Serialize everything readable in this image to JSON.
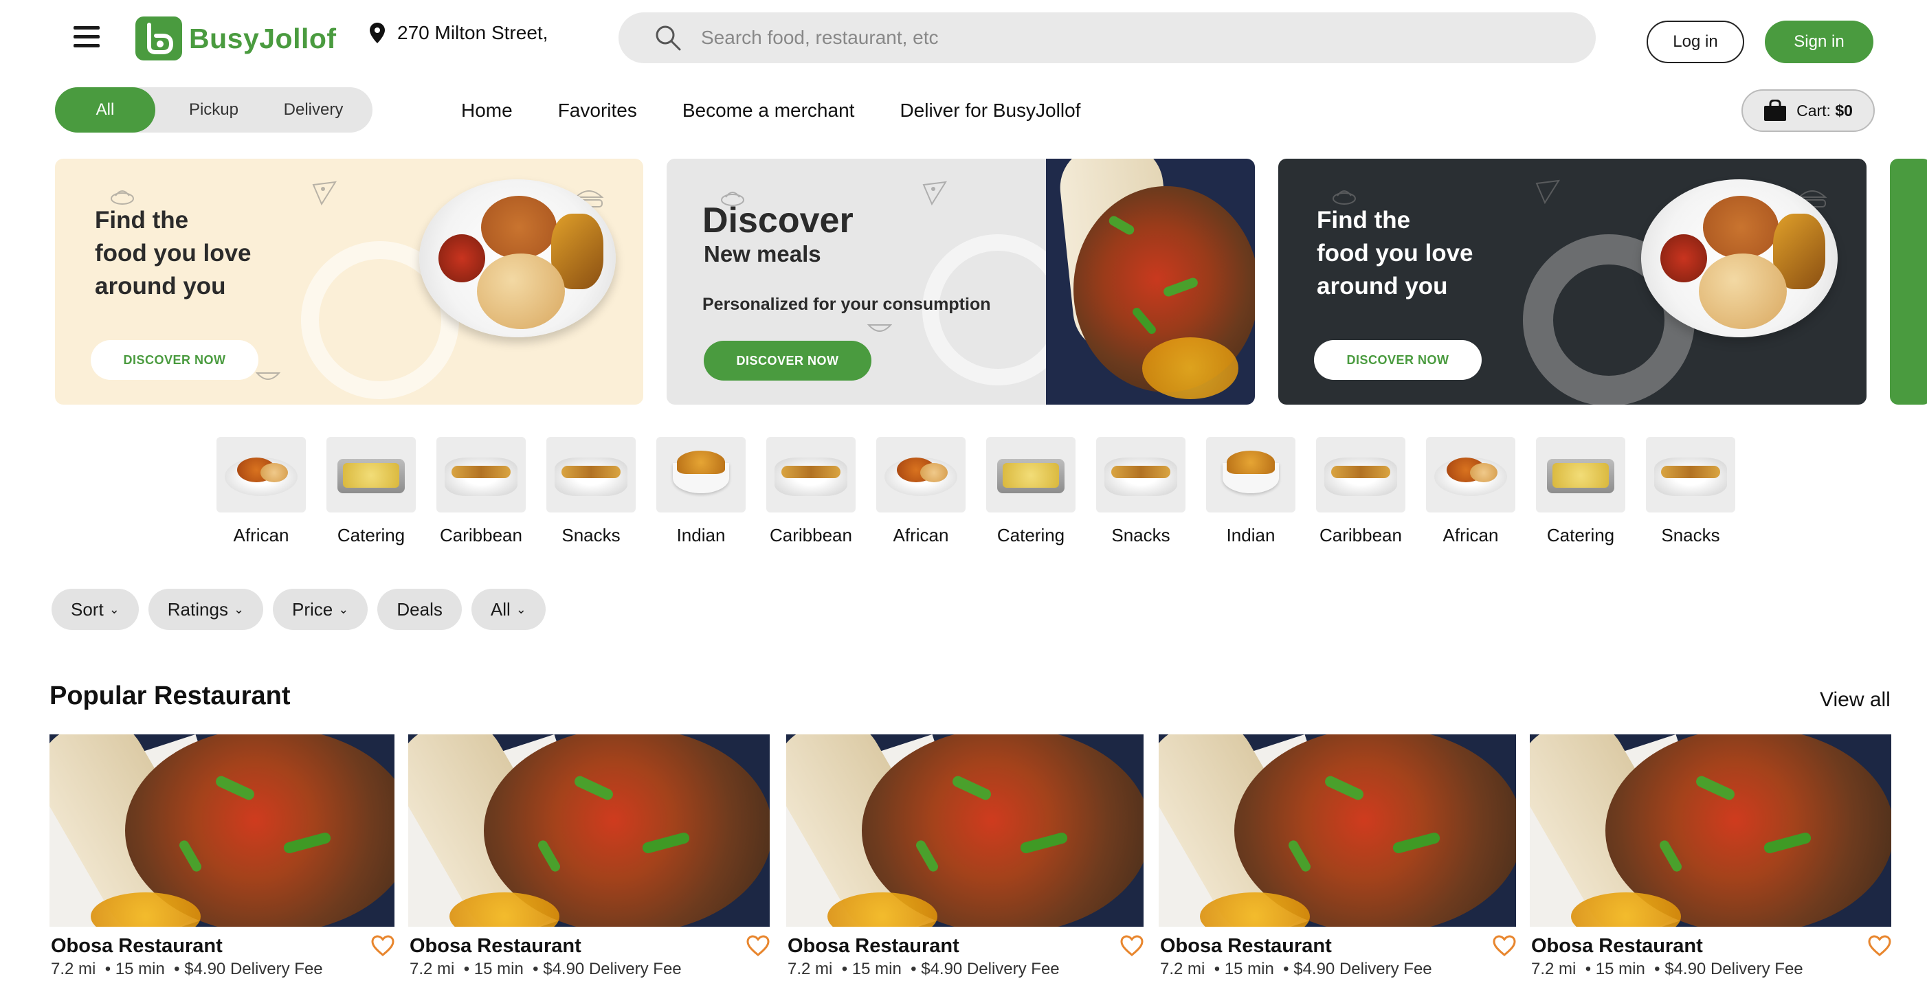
{
  "header": {
    "brand": "BusyJollof",
    "location": "270 Milton Street,",
    "search_placeholder": "Search food, restaurant, etc",
    "login_label": "Log in",
    "signin_label": "Sign in"
  },
  "modes": [
    "All",
    "Pickup",
    "Delivery"
  ],
  "nav": [
    "Home",
    "Favorites",
    "Become a merchant",
    "Deliver for BusyJollof"
  ],
  "cart": {
    "label": "Cart: ",
    "amount": "$0"
  },
  "banners": [
    {
      "line1": "Find the",
      "line2": "food you love",
      "line3": "around you",
      "cta": "DISCOVER NOW"
    },
    {
      "title": "Discover",
      "subtitle": "New meals",
      "tagline": "Personalized for your consumption",
      "cta": "DISCOVER NOW"
    },
    {
      "line1": "Find the",
      "line2": "food you love",
      "line3": "around you",
      "cta": "DISCOVER NOW"
    }
  ],
  "categories": [
    "African",
    "Catering",
    "Caribbean",
    "Snacks",
    "Indian",
    "Caribbean",
    "African",
    "Catering",
    "Snacks",
    "Indian",
    "Caribbean",
    "African",
    "Catering",
    "Snacks"
  ],
  "filters": [
    {
      "label": "Sort",
      "dropdown": true
    },
    {
      "label": "Ratings",
      "dropdown": true
    },
    {
      "label": "Price",
      "dropdown": true
    },
    {
      "label": "Deals",
      "dropdown": false
    },
    {
      "label": "All",
      "dropdown": true
    }
  ],
  "popular": {
    "title": "Popular Restaurant",
    "view_all": "View all",
    "restaurants": [
      {
        "name": "Obosa Restaurant",
        "distance": "7.2 mi",
        "time": "15 min",
        "fee": "$4.90 Delivery Fee"
      },
      {
        "name": "Obosa Restaurant",
        "distance": "7.2 mi",
        "time": "15 min",
        "fee": "$4.90 Delivery Fee"
      },
      {
        "name": "Obosa Restaurant",
        "distance": "7.2 mi",
        "time": "15 min",
        "fee": "$4.90 Delivery Fee"
      },
      {
        "name": "Obosa Restaurant",
        "distance": "7.2 mi",
        "time": "15 min",
        "fee": "$4.90 Delivery Fee"
      },
      {
        "name": "Obosa Restaurant",
        "distance": "7.2 mi",
        "time": "15 min",
        "fee": "$4.90 Delivery Fee"
      }
    ]
  },
  "colors": {
    "brand_green": "#4a9b3f",
    "heart_orange": "#e8862e",
    "banner_cream": "#fbefd7",
    "banner_dark": "#2a2f33"
  }
}
